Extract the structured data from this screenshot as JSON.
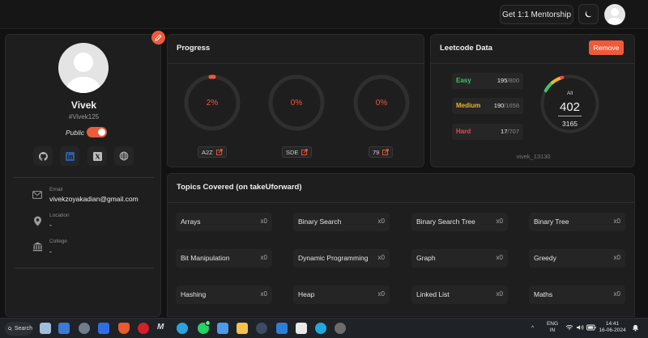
{
  "topbar": {
    "mentorship_label": "Get 1:1 Mentorship",
    "theme_icon": "moon-icon",
    "avatar_icon": "user-avatar-icon"
  },
  "profile": {
    "name": "Vivek",
    "handle": "#Vivek125",
    "public_label": "Public",
    "public_enabled": true,
    "socials": [
      "github-icon",
      "linkedin-icon",
      "x-twitter-icon",
      "globe-icon"
    ],
    "email_label": "Email",
    "email_value": "vivekzoyakadian@gmail.com",
    "location_label": "Location",
    "location_value": "-",
    "college_label": "College",
    "college_value": "-"
  },
  "progress": {
    "title": "Progress",
    "items": [
      {
        "label": "A2Z",
        "percent_text": "2%",
        "percent": 2
      },
      {
        "label": "SDE",
        "percent_text": "0%",
        "percent": 0
      },
      {
        "label": "79",
        "percent_text": "0%",
        "percent": 0
      }
    ]
  },
  "leetcode": {
    "title": "Leetcode Data",
    "remove_label": "Remove",
    "rows": [
      {
        "label": "Easy",
        "solved": "195",
        "total": "/800",
        "color": "#3ec46d"
      },
      {
        "label": "Medium",
        "solved": "190",
        "total": "/1658",
        "color": "#f0b429"
      },
      {
        "label": "Hard",
        "solved": "17",
        "total": "/707",
        "color": "#f0445a"
      }
    ],
    "all_label": "All",
    "solved": "402",
    "total": "3165",
    "username": "vivek_13130"
  },
  "topics": {
    "title": "Topics Covered (on takeUforward)",
    "items": [
      {
        "name": "Arrays",
        "count": "x0"
      },
      {
        "name": "Binary Search",
        "count": "x0"
      },
      {
        "name": "Binary Search Tree",
        "count": "x0"
      },
      {
        "name": "Binary Tree",
        "count": "x0"
      },
      {
        "name": "Bit Manipulation",
        "count": "x0"
      },
      {
        "name": "Dynamic Programming",
        "count": "x0"
      },
      {
        "name": "Graph",
        "count": "x0"
      },
      {
        "name": "Greedy",
        "count": "x0"
      },
      {
        "name": "Hashing",
        "count": "x0"
      },
      {
        "name": "Heap",
        "count": "x0"
      },
      {
        "name": "Linked List",
        "count": "x0"
      },
      {
        "name": "Maths",
        "count": "x0"
      }
    ]
  },
  "taskbar": {
    "search_label": "Search",
    "lang_line1": "ENG",
    "lang_line2": "IN",
    "time": "14:41",
    "date": "16-06-2024",
    "whatsapp_badge": "4"
  },
  "colors": {
    "accent": "#ef5a3a",
    "background": "#121212",
    "card": "#1e1e1e"
  }
}
